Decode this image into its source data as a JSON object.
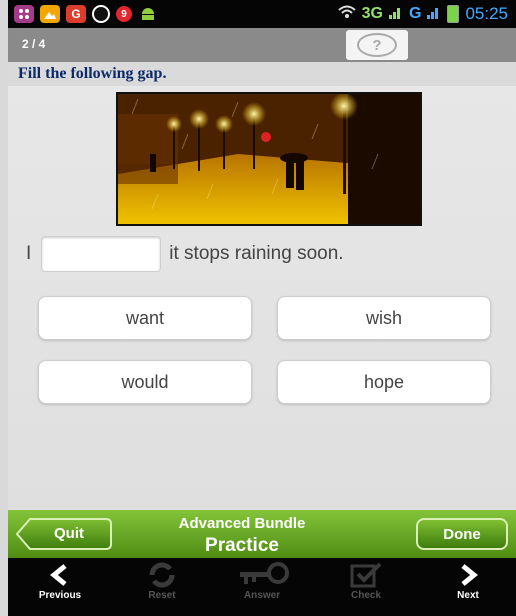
{
  "status_bar": {
    "network_label": "3G",
    "network2_label": "G",
    "time": "05:25",
    "icons": [
      "bbm-icon",
      "gallery-icon",
      "google-plus-icon",
      "whatsapp-icon",
      "notification-count-icon",
      "android-icon"
    ],
    "notification_count": "9"
  },
  "header": {
    "progress": "2 / 4",
    "help_icon": "question-mark-icon"
  },
  "instruction": "Fill the following gap.",
  "question": {
    "prefix": "I",
    "blank_value": "",
    "suffix": "it stops raining soon."
  },
  "options": [
    {
      "label": "want"
    },
    {
      "label": "wish"
    },
    {
      "label": "would"
    },
    {
      "label": "hope"
    }
  ],
  "action_bar": {
    "quit_label": "Quit",
    "title_line1": "Advanced Bundle",
    "title_line2": "Practice",
    "done_label": "Done",
    "colors": {
      "green_top": "#84c43a",
      "green_bottom": "#4f8c13"
    }
  },
  "bottom_nav": {
    "previous": "Previous",
    "reset": "Reset",
    "answer": "Answer",
    "check": "Check",
    "next": "Next"
  }
}
